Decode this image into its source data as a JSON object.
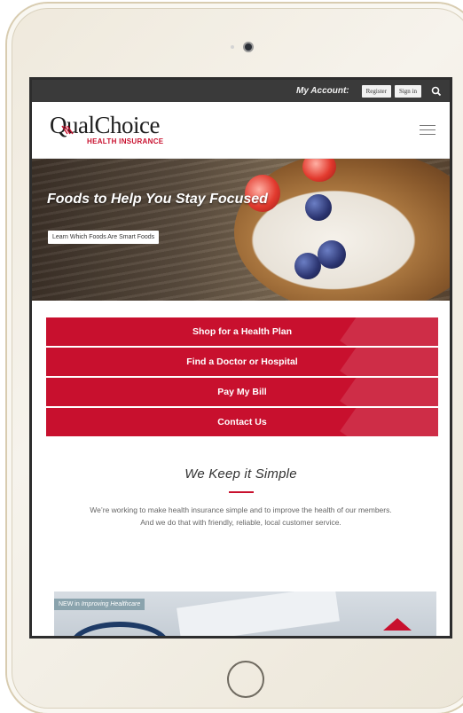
{
  "topbar": {
    "account_label": "My Account:",
    "register_label": "Register",
    "signin_label": "Sign in",
    "search_icon": "search-icon"
  },
  "header": {
    "logo_text": "QualChoice",
    "logo_subtext": "HEALTH INSURANCE",
    "menu_icon": "hamburger-menu-icon"
  },
  "hero": {
    "title": "Foods to Help You Stay Focused",
    "button_label": "Learn Which Foods Are Smart Foods"
  },
  "actions": [
    {
      "label": "Shop for a Health Plan"
    },
    {
      "label": "Find a Doctor or Hospital"
    },
    {
      "label": "Pay My Bill"
    },
    {
      "label": "Contact Us"
    }
  ],
  "simple_section": {
    "heading": "We Keep it Simple",
    "line1": "We’re working to make health insurance simple and to improve the health of our members.",
    "line2": "And we do that with friendly, reliable, local customer service."
  },
  "feature": {
    "tag_prefix": "NEW in",
    "tag_category": "Improving Healthcare"
  },
  "colors": {
    "brand_red": "#c8102e",
    "topbar": "#3a3a3a",
    "device_frame": "#efe9dc"
  }
}
